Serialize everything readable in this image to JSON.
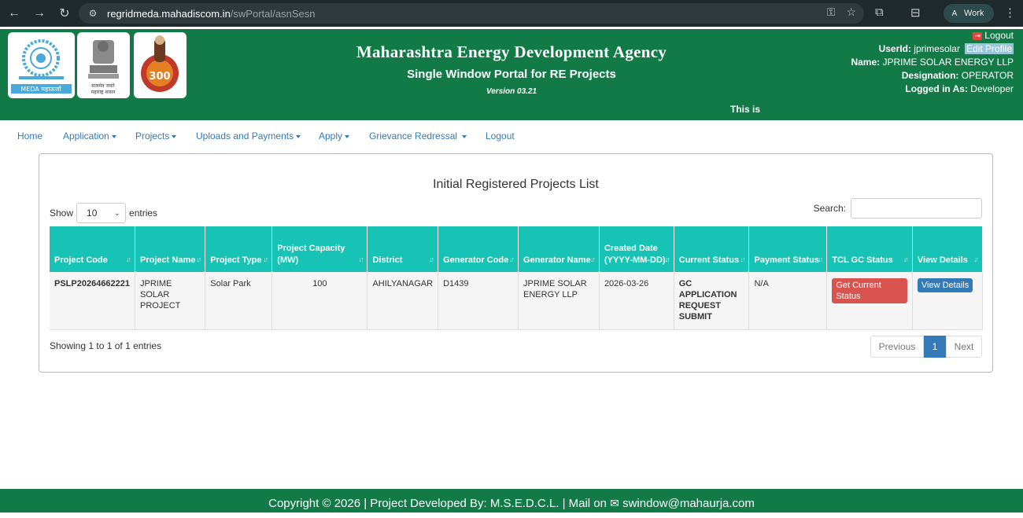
{
  "browser": {
    "url_host": "regridmeda.mahadiscom.in",
    "url_path": "/swPortal/asnSesn",
    "profile_initial": "A",
    "profile_label": "Work",
    "back_icon": "←",
    "forward_icon": "→",
    "reload_icon": "↻",
    "menu_icon": "⋮"
  },
  "header": {
    "agency": "Maharashtra Energy Development Agency",
    "portal": "Single Window Portal for RE Projects",
    "version": "Version 03.21",
    "marquee": "This is",
    "logout": "Logout",
    "userid_label": "UserId:",
    "userid": "jprimesolar",
    "edit_profile": "Edit Profile",
    "name_label": "Name:",
    "name": "JPRIME SOLAR ENERGY LLP",
    "designation_label": "Designation:",
    "designation": "OPERATOR",
    "logged_label": "Logged in As:",
    "logged_as": "Developer",
    "logo_meda_text": "MEDA महाऊर्जा",
    "logo_emblem_text": "सत्यमेव जयते",
    "logo_emblem_text2": "महाराष्ट्र शासन",
    "logo_third_text": "300"
  },
  "nav": {
    "items": [
      {
        "label": "Home",
        "dropdown": false
      },
      {
        "label": "Application",
        "dropdown": true
      },
      {
        "label": "Projects",
        "dropdown": true
      },
      {
        "label": "Uploads and Payments",
        "dropdown": true
      },
      {
        "label": "Apply",
        "dropdown": true
      },
      {
        "label": "Grievance Redressal",
        "dropdown": true
      },
      {
        "label": "Logout",
        "dropdown": false
      }
    ]
  },
  "panel": {
    "title": "Initial Registered Projects List",
    "show_label": "Show",
    "entries_value": "10",
    "entries_label": "entries",
    "search_label": "Search:",
    "search_value": "",
    "showing_text": "Showing 1 to 1 of 1 entries",
    "prev_label": "Previous",
    "page_current": "1",
    "next_label": "Next"
  },
  "table": {
    "headers": [
      "Project Code",
      "Project Name",
      "Project Type",
      "Project Capacity (MW)",
      "District",
      "Generator Code",
      "Generator Name",
      "Created Date (YYYY-MM-DD)",
      "Current Status",
      "Payment Status",
      "TCL GC Status",
      "View Details"
    ],
    "rows": [
      {
        "project_code": "PSLP20264662221",
        "project_name": "JPRIME SOLAR PROJECT",
        "project_type": "Solar Park",
        "capacity": "100",
        "district": "AHILYANAGAR",
        "generator_code": "D1439",
        "generator_name": "JPRIME SOLAR ENERGY LLP",
        "created_date": "2026-03-26",
        "current_status": "GC APPLICATION REQUEST SUBMIT",
        "payment_status": "N/A",
        "tcl_button": "Get Current Status",
        "view_button": "View Details"
      }
    ]
  },
  "footer": {
    "text": "Copyright © 2026 | Project Developed By: M.S.E.D.C.L. | Mail on",
    "email": "swindow@mahaurja.com"
  },
  "colors": {
    "header_green": "#117a47",
    "table_header_teal": "#17c3b4",
    "link_blue": "#337ab7",
    "danger_red": "#d9534f"
  }
}
